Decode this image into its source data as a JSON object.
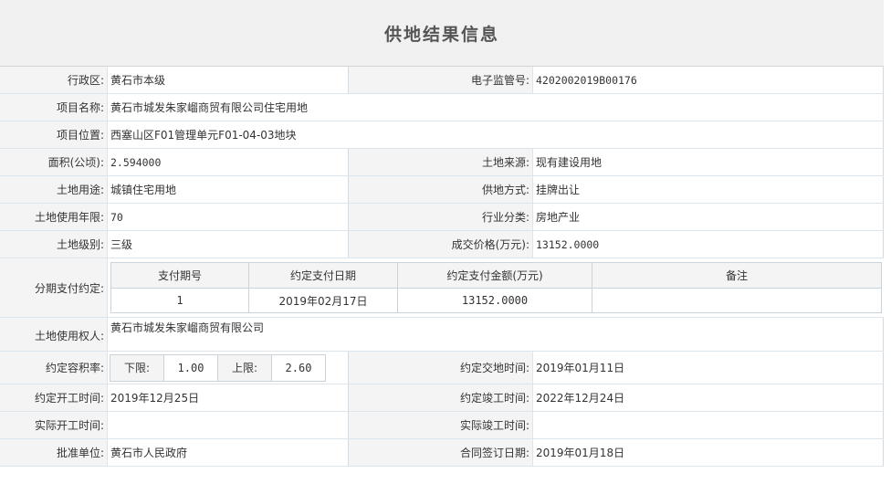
{
  "page_title": "供地结果信息",
  "fields": {
    "district_label": "行政区:",
    "district_value": "黄石市本级",
    "supervision_no_label": "电子监管号:",
    "supervision_no_value": "4202002019B00176",
    "project_name_label": "项目名称:",
    "project_name_value": "黄石市城发朱家嵧商贸有限公司住宅用地",
    "project_location_label": "项目位置:",
    "project_location_value": "西塞山区F01管理单元F01-04-03地块",
    "area_label": "面积(公顷):",
    "area_value": "2.594000",
    "land_source_label": "土地来源:",
    "land_source_value": "现有建设用地",
    "land_use_label": "土地用途:",
    "land_use_value": "城镇住宅用地",
    "supply_method_label": "供地方式:",
    "supply_method_value": "挂牌出让",
    "use_years_label": "土地使用年限:",
    "use_years_value": "70",
    "industry_label": "行业分类:",
    "industry_value": "房地产业",
    "land_grade_label": "土地级别:",
    "land_grade_value": "三级",
    "price_label": "成交价格(万元):",
    "price_value": "13152.0000",
    "installment_label": "分期支付约定:",
    "land_user_label": "土地使用权人:",
    "land_user_value": "黄石市城发朱家嵧商贸有限公司",
    "far_label": "约定容积率:",
    "delivery_time_label": "约定交地时间:",
    "delivery_time_value": "2019年01月11日",
    "start_time_label": "约定开工时间:",
    "start_time_value": "2019年12月25日",
    "complete_time_label": "约定竣工时间:",
    "complete_time_value": "2022年12月24日",
    "actual_start_label": "实际开工时间:",
    "actual_start_value": "",
    "actual_complete_label": "实际竣工时间:",
    "actual_complete_value": "",
    "approval_label": "批准单位:",
    "approval_value": "黄石市人民政府",
    "contract_date_label": "合同签订日期:",
    "contract_date_value": "2019年01月18日"
  },
  "payment_table": {
    "headers": [
      "支付期号",
      "约定支付日期",
      "约定支付金额(万元)",
      "备注"
    ],
    "rows": [
      [
        "1",
        "2019年02月17日",
        "13152.0000",
        ""
      ]
    ]
  },
  "far": {
    "lower_label": "下限:",
    "lower_value": "1.00",
    "upper_label": "上限:",
    "upper_value": "2.60"
  }
}
